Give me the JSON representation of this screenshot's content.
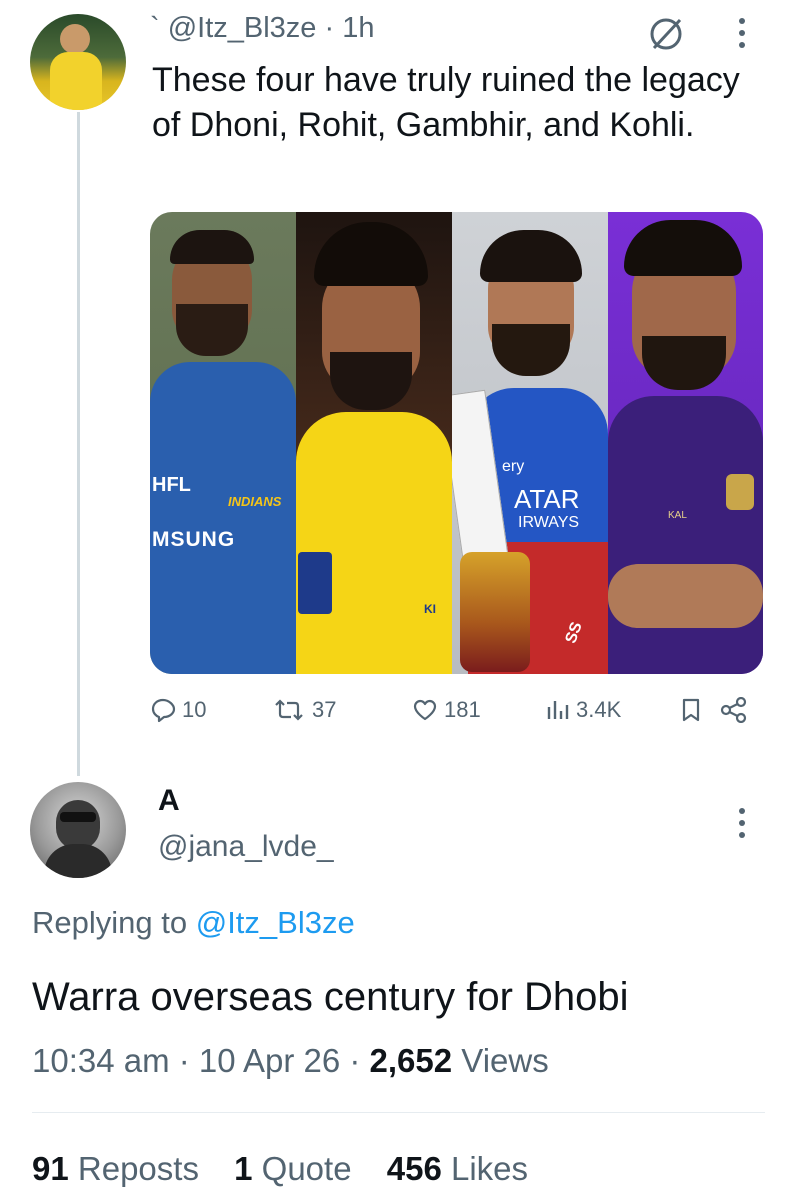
{
  "parent_tweet": {
    "handle": "` @Itz_Bl3ze · 1h",
    "text": "These four have truly ruined the legacy of Dhoni, Rohit, Gambhir, and Kohli.",
    "media_jersey_text": [
      "HFL",
      "INDIANS",
      "MSUNG",
      "ery",
      "ATAR",
      "IRWAYS",
      "KI",
      "SS",
      "KAL"
    ],
    "actions": {
      "replies": "10",
      "reposts": "37",
      "likes": "181",
      "views": "3.4K"
    }
  },
  "reply_tweet": {
    "display_name": "A",
    "handle": "@jana_lvde_",
    "replying_prefix": "Replying to ",
    "replying_to": "@Itz_Bl3ze",
    "text": "Warra overseas century for Dhobi",
    "time": "10:34 am · 10 Apr 26 · ",
    "views_count": "2,652",
    "views_label": " Views"
  },
  "stats": {
    "reposts_count": "91",
    "reposts_label": " Reposts",
    "quote_count": "1",
    "quote_label": " Quote",
    "likes_count": "456",
    "likes_label": " Likes"
  },
  "colors": {
    "link": "#1d9bf0",
    "secondary_text": "#536471",
    "primary_text": "#0f1419"
  },
  "icons": [
    "grok-icon",
    "more-icon",
    "reply-icon",
    "repost-icon",
    "like-icon",
    "views-icon",
    "bookmark-icon",
    "share-icon"
  ]
}
